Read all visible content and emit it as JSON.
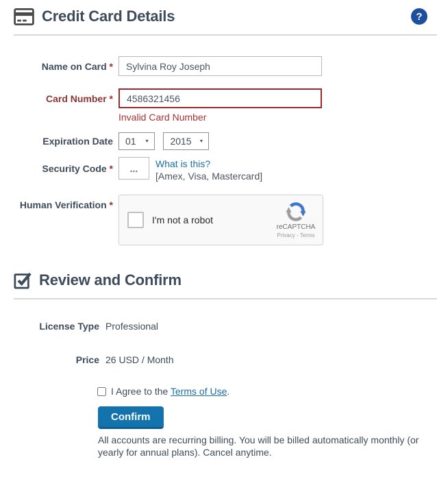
{
  "header": {
    "title": "Credit Card Details",
    "help_glyph": "?"
  },
  "form": {
    "required_marker": "*",
    "name_label": "Name on Card",
    "name_value": "Sylvina Roy Joseph",
    "card_label": "Card Number",
    "card_value": "4586321456",
    "card_error": "Invalid Card Number",
    "exp_label": "Expiration Date",
    "exp_month": "01",
    "exp_year": "2015",
    "security_label": "Security Code",
    "security_placeholder": "...",
    "security_help_link": "What is this?",
    "security_help_note": "[Amex, Visa, Mastercard]",
    "human_label": "Human Verification"
  },
  "recaptcha": {
    "checkbox_label": "I'm not a robot",
    "brand": "reCAPTCHA",
    "links": "Privacy - Terms"
  },
  "review": {
    "title": "Review and Confirm",
    "license_label": "License Type",
    "license_value": "Professional",
    "price_label": "Price",
    "price_value": "26 USD / Month",
    "agree_prefix": "I Agree to the ",
    "agree_link": "Terms of Use",
    "agree_suffix": ".",
    "confirm_label": "Confirm",
    "fine_print": "All accounts are recurring billing. You will be billed automatically monthly (or yearly for annual plans). Cancel anytime."
  },
  "colors": {
    "heading_text": "#3e4b5b",
    "accent_blue": "#1373ad",
    "link_blue": "#1a6fa8",
    "error_red": "#ab3134",
    "error_border": "#9e2a2b",
    "help_icon_blue": "#1c4f9e",
    "divider_gray": "#d8d8d8"
  }
}
